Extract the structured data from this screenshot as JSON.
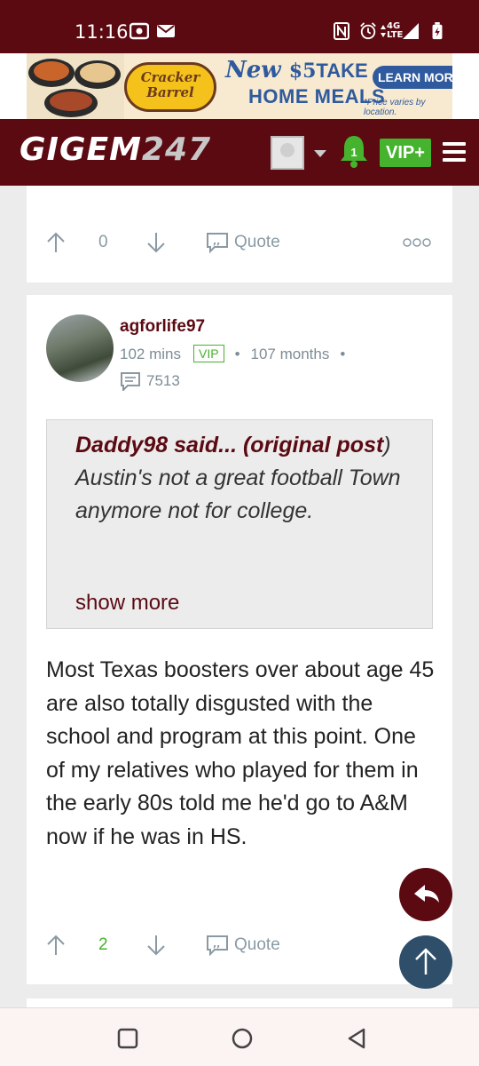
{
  "status_bar": {
    "time": "11:16",
    "network": "4G",
    "network_sub": "LTE"
  },
  "ad": {
    "brand_line1": "Cracker",
    "brand_line2": "Barrel",
    "headline": "New",
    "price": "$5",
    "headline_suffix": "TAKE",
    "subheadline": "HOME MEALS",
    "cta": "LEARN MORE",
    "fine_print": "*Price varies by location."
  },
  "header": {
    "logo_text": "GIGEM",
    "logo_number": "247",
    "notification_count": "1",
    "vip_label": "VIP+"
  },
  "top_post": {
    "vote_count": "0",
    "quote_label": "Quote"
  },
  "post": {
    "username": "agforlife97",
    "time_ago": "102 mins",
    "badge": "VIP",
    "tenure": "107 months",
    "post_count": "7513",
    "quote": {
      "author_prefix": "Daddy98 said... (",
      "author_link": "original post",
      "author_suffix": ")",
      "text": " Austin's not a great football Town anymore not for college.",
      "show_more": "show more"
    },
    "body": "Most Texas boosters over about age 45 are also totally disgusted with the school and program at this point. One of my relatives who played for them in the early 80s told me he'd go to A&M now if he was in HS.",
    "vote_count": "2",
    "quote_label": "Quote"
  }
}
